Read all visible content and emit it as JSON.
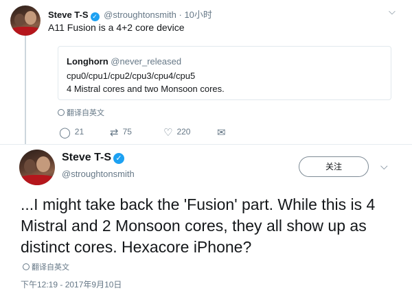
{
  "quoted_reply_tweet": {
    "author_name": "Steve T-S",
    "author_handle": "@stroughtonsmith",
    "time": "10小时",
    "separator": "·",
    "text": "A11 Fusion is a 4+2 core device",
    "quote": {
      "author_name": "Longhorn",
      "author_handle": "@never_released",
      "line1": "cpu0/cpu1/cpu2/cpu3/cpu4/cpu5",
      "line2": "4 Mistral cores and two Monsoon cores."
    },
    "translate_label": "翻译自英文",
    "actions": {
      "replies": "21",
      "retweets": "75",
      "likes": "220"
    }
  },
  "main_tweet": {
    "author_name": "Steve T-S",
    "author_handle": "@stroughtonsmith",
    "follow_label": "关注",
    "text": "...I might take back the 'Fusion' part. While this is 4 Mistral and 2 Monsoon cores, they all show up as distinct cores. Hexacore iPhone?",
    "translate_label": "翻译自英文",
    "timestamp": "下午12:19 - 2017年9月10日"
  },
  "icons": {
    "verified": "verified-badge-icon",
    "reply": "reply-icon",
    "retweet": "retweet-icon",
    "like": "heart-icon",
    "dm": "envelope-icon",
    "translate": "globe-icon",
    "more": "chevron-down-icon"
  },
  "colors": {
    "verified_blue": "#1da1f2",
    "muted_text": "#657786",
    "border": "#e1e8ed"
  }
}
